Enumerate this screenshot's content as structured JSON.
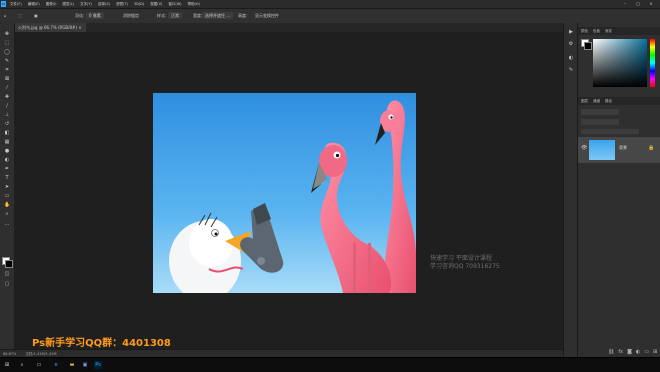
{
  "app": {
    "logo": "Ps"
  },
  "menubar": {
    "items": [
      "文件(F)",
      "编辑(E)",
      "图像(I)",
      "图层(L)",
      "文字(Y)",
      "选择(S)",
      "滤镜(T)",
      "3D(D)",
      "视图(V)",
      "窗口(W)",
      "帮助(H)"
    ]
  },
  "optionsbar": {
    "feather_label": "羽化:",
    "feather_value": "0 像素",
    "antialias_label": "消除锯齿",
    "style_label": "样式:",
    "style_value": "正常",
    "width_label": "宽度:",
    "height_label": "高度:",
    "select_mask_button": "选择并遮住 ...",
    "checkbox_label": "显示变换控件"
  },
  "document": {
    "tab_title": "火烈鸟.jpg @ 66.7% (RGB/8#)"
  },
  "workspace": {
    "watermark_line1": "快速学习  平面设计课程",
    "watermark_line2": "学习咨询QQ 709316275",
    "promo_text": "Ps新手学习QQ群：4401308"
  },
  "statusbar": {
    "zoom": "66.67%",
    "doc_info": "文档:1.41M/1.41M"
  },
  "color_panel": {
    "tabs": [
      "颜色",
      "色板",
      "渐变"
    ]
  },
  "layers_panel": {
    "tabs": [
      "图层",
      "通道",
      "路径"
    ],
    "layer_name": "背景"
  },
  "taskbar": {
    "items": [
      "start",
      "search",
      "task-view",
      "edge",
      "explorer",
      "store",
      "photoshop"
    ]
  },
  "colors": {
    "accent": "#31a8ff",
    "promo": "#ff9b1a",
    "sky_top": "#2f8fe0",
    "flamingo": "#f2728a"
  }
}
